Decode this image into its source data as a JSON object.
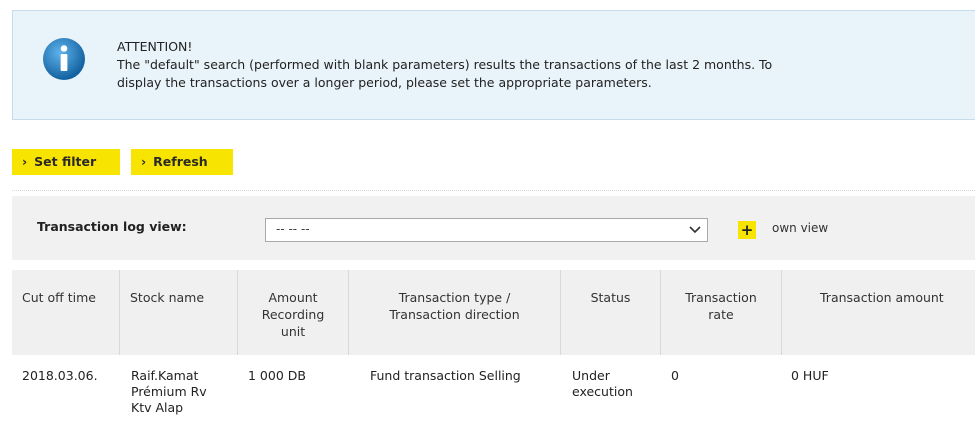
{
  "notice": {
    "icon": "info-icon",
    "title": "ATTENTION!",
    "line1": "The \"default\" search (performed with blank parameters) results the transactions of the last 2 months. To",
    "line2": "display the transactions over a longer period, please set the appropriate parameters."
  },
  "toolbar": {
    "set_filter": "Set filter",
    "refresh": "Refresh"
  },
  "view": {
    "label": "Transaction log view:",
    "selected": "-- -- --",
    "own_view": "own view"
  },
  "table": {
    "headers": {
      "cut_off_time": "Cut off time",
      "stock_name": "Stock name",
      "amount_1": "Amount",
      "amount_2": "Recording",
      "amount_3": "unit",
      "type_1": "Transaction type /",
      "type_2": "Transaction direction",
      "status": "Status",
      "rate_1": "Transaction",
      "rate_2": "rate",
      "tx_amount": "Transaction amount"
    },
    "row": {
      "cut_off_time": "2018.03.06.",
      "stock_1": "Raif.Kamat",
      "stock_2": "Prémium Rv",
      "stock_3": "Ktv Alap",
      "amount": "1 000 DB",
      "type": "Fund transaction Selling",
      "status_1": "Under",
      "status_2": "execution",
      "rate": "0",
      "tx_amount": "0 HUF"
    }
  },
  "colors": {
    "notice_bg": "#e9f3fa",
    "accent_yellow": "#f7e400",
    "info_blue": "#1d7fc8"
  }
}
